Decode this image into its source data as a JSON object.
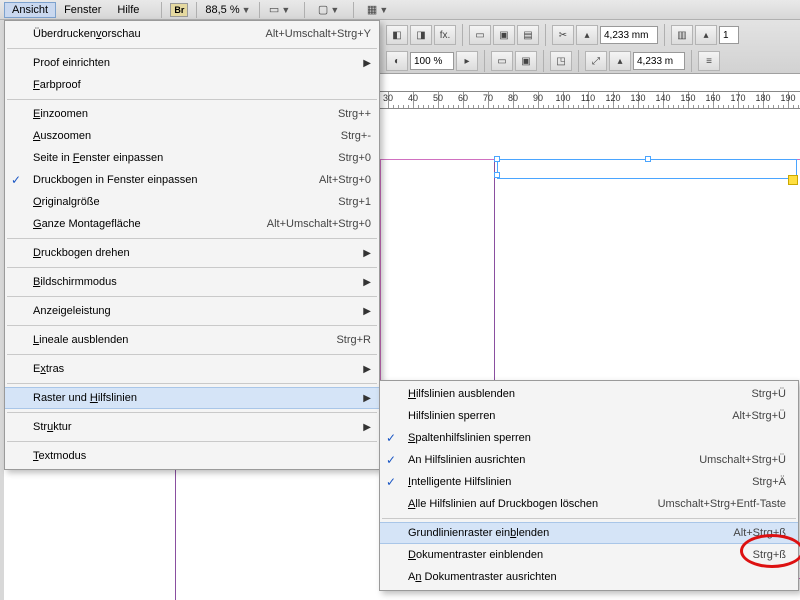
{
  "menus": {
    "view": "Ansicht",
    "window": "Fenster",
    "help": "Hilfe"
  },
  "bridge_label": "Br",
  "zoom_level": "88,5 %",
  "optionsbar": {
    "fx": "fx.",
    "percent": "100 %",
    "dim1": "4,233 mm",
    "step": "1",
    "dim2": "4,233 m"
  },
  "ruler_ticks": [
    30,
    40,
    50,
    60,
    70,
    80,
    90,
    100,
    110,
    120,
    130,
    140,
    150,
    160,
    170,
    180,
    190
  ],
  "view_menu": [
    {
      "type": "item",
      "label": "Überdruckenvorschau",
      "mnem": "v",
      "shortcut": "Alt+Umschalt+Strg+Y"
    },
    {
      "type": "sep"
    },
    {
      "type": "item",
      "label": "Proof einrichten",
      "arrow": true
    },
    {
      "type": "item",
      "label": "Farbproof",
      "mnem": "F"
    },
    {
      "type": "sep"
    },
    {
      "type": "item",
      "label": "Einzoomen",
      "mnem": "E",
      "shortcut": "Strg++"
    },
    {
      "type": "item",
      "label": "Auszoomen",
      "mnem": "A",
      "shortcut": "Strg+-"
    },
    {
      "type": "item",
      "label": "Seite in Fenster einpassen",
      "mnem": "F",
      "shortcut": "Strg+0"
    },
    {
      "type": "item",
      "label": "Druckbogen in Fenster einpassen",
      "checked": true,
      "shortcut": "Alt+Strg+0"
    },
    {
      "type": "item",
      "label": "Originalgröße",
      "mnem": "O",
      "shortcut": "Strg+1"
    },
    {
      "type": "item",
      "label": "Ganze Montagefläche",
      "mnem": "G",
      "shortcut": "Alt+Umschalt+Strg+0"
    },
    {
      "type": "sep"
    },
    {
      "type": "item",
      "label": "Druckbogen drehen",
      "mnem": "d",
      "arrow": true
    },
    {
      "type": "sep"
    },
    {
      "type": "item",
      "label": "Bildschirmmodus",
      "mnem": "B",
      "arrow": true
    },
    {
      "type": "sep"
    },
    {
      "type": "item",
      "label": "Anzeigeleistung",
      "arrow": true
    },
    {
      "type": "sep"
    },
    {
      "type": "item",
      "label": "Lineale ausblenden",
      "mnem": "L",
      "shortcut": "Strg+R"
    },
    {
      "type": "sep"
    },
    {
      "type": "item",
      "label": "Extras",
      "mnem": "x",
      "arrow": true
    },
    {
      "type": "sep"
    },
    {
      "type": "item",
      "label": "Raster und Hilfslinien",
      "mnem": "H",
      "arrow": true,
      "hover": true
    },
    {
      "type": "sep"
    },
    {
      "type": "item",
      "label": "Struktur",
      "mnem": "u",
      "arrow": true
    },
    {
      "type": "sep"
    },
    {
      "type": "item",
      "label": "Textmodus",
      "mnem": "T"
    }
  ],
  "submenu": [
    {
      "type": "item",
      "label": "Hilfslinien ausblenden",
      "mnem": "H",
      "shortcut": "Strg+Ü"
    },
    {
      "type": "item",
      "label": "Hilfslinien sperren",
      "shortcut": "Alt+Strg+Ü"
    },
    {
      "type": "item",
      "label": "Spaltenhilfslinien sperren",
      "mnem": "S",
      "checked": true
    },
    {
      "type": "item",
      "label": "An Hilfslinien ausrichten",
      "checked": true,
      "shortcut": "Umschalt+Strg+Ü"
    },
    {
      "type": "item",
      "label": "Intelligente Hilfslinien",
      "mnem": "I",
      "checked": true,
      "shortcut": "Strg+Ä"
    },
    {
      "type": "item",
      "label": "Alle Hilfslinien auf Druckbogen löschen",
      "mnem": "A",
      "shortcut": "Umschalt+Strg+Entf-Taste"
    },
    {
      "type": "sep"
    },
    {
      "type": "item",
      "label": "Grundlinienraster einblenden",
      "mnem": "b",
      "hover": true,
      "shortcut": "Alt+Strg+ß"
    },
    {
      "type": "item",
      "label": "Dokumentraster einblenden",
      "mnem": "D",
      "shortcut": "Strg+ß"
    },
    {
      "type": "item",
      "label": "An Dokumentraster ausrichten",
      "mnem": "n"
    }
  ]
}
